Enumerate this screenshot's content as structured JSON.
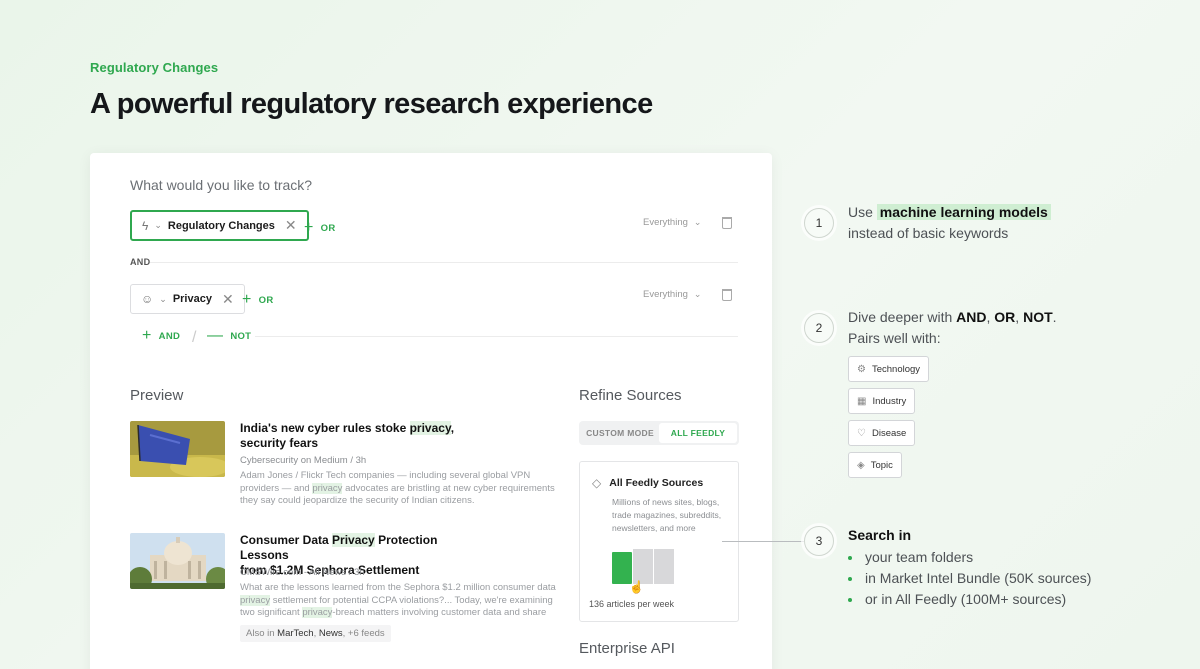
{
  "eyebrow": "Regulatory Changes",
  "headline": "A powerful regulatory research experience",
  "card": {
    "track_label": "What would you like to track?",
    "rules": [
      {
        "chip_label": "Regulatory Changes",
        "add_or": "OR",
        "scope": "Everything"
      },
      {
        "chip_label": "Privacy",
        "add_or": "OR",
        "scope": "Everything"
      }
    ],
    "and_label": "AND",
    "add_and": "AND",
    "add_not": "NOT",
    "preview_title": "Preview",
    "articles": [
      {
        "title_pre": "India's new cyber rules stoke ",
        "title_hl": "privacy",
        "title_post": ",",
        "title_line2": "security fears",
        "source": "Cybersecurity on Medium / 3h",
        "desc_a": "Adam Jones / Flickr Tech companies — including several global VPN providers — and ",
        "desc_hl": "privacy",
        "desc_b": " advocates are bristling at new cyber requirements they say could jeopardize the security of Indian citizens."
      },
      {
        "title_pre": "Consumer Data ",
        "title_hl": "Privacy",
        "title_post": " Protection Lessons",
        "title_line2": "from $1.2M Sephora Settlement",
        "source": "CMSWire.com - All News / 3h",
        "desc_a": "What are the lessons learned from the Sephora $1.2 million consumer data ",
        "desc_hl": "privacy",
        "desc_b": " settlement for potential CCPA violations?... Today, we're examining two significant ",
        "desc_hl2": "privacy",
        "desc_c": "-breach matters involving customer data and share",
        "also_prefix": "Also in ",
        "also_feed1": "MarTech",
        "also_sep": ", ",
        "also_feed2": "News",
        "also_more": ", +6 feeds"
      }
    ],
    "refine_title": "Refine Sources",
    "toggle": {
      "custom": "CUSTOM MODE",
      "all": "ALL FEEDLY"
    },
    "sources": {
      "title": "All Feedly Sources",
      "desc": "Millions of news sites, blogs, trade magazines, subreddits, newsletters, and more",
      "count": "136 articles per week"
    },
    "enterprise_title": "Enterprise API"
  },
  "steps": {
    "one": {
      "num": "1",
      "pre": "Use ",
      "hl": "machine learning models",
      "line2": "instead of basic keywords"
    },
    "two": {
      "num": "2",
      "pre": "Dive deeper with ",
      "and": "AND",
      "sep1": ", ",
      "or": "OR",
      "sep2": ", ",
      "not": "NOT",
      "end": ".",
      "line2": "Pairs well with:",
      "tags": [
        "Technology",
        "Industry",
        "Disease",
        "Topic"
      ]
    },
    "three": {
      "num": "3",
      "title": "Search in",
      "items": [
        "your team folders",
        "in Market Intel Bundle (50K sources)",
        "or in All Feedly (100M+ sources)"
      ]
    }
  },
  "colors": {
    "accent": "#2fa84f",
    "highlight": "#e3f3e4",
    "background": "#eef6ee"
  },
  "icons": [
    "bolt-icon",
    "chevron-down-icon",
    "close-icon",
    "plus-icon",
    "minus-icon",
    "trash-icon",
    "topic-face-icon",
    "sources-icon",
    "gear-icon",
    "chart-icon",
    "heart-icon",
    "tag-icon",
    "hand-cursor-icon"
  ]
}
